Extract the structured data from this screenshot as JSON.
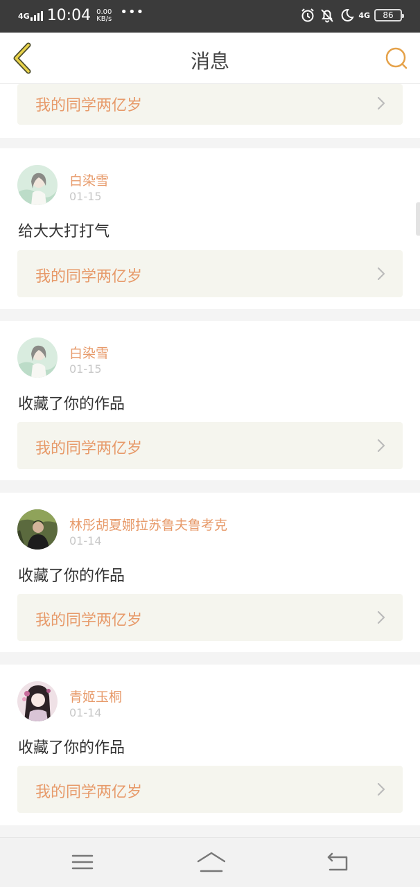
{
  "status_bar": {
    "network": "4G",
    "time": "10:04",
    "speed_value": "0.00",
    "speed_unit": "KB/s",
    "more": "•••",
    "network_right": "4G",
    "battery": "86",
    "icons": [
      "alarm-icon",
      "notifications-off-icon",
      "moon-icon"
    ]
  },
  "header": {
    "title": "消息",
    "accent_color": "#e5a24a"
  },
  "feed": {
    "top_partial_link": "我的同学两亿岁",
    "items": [
      {
        "name": "白染雪",
        "date": "01-15",
        "message": "给大大打打气",
        "work": "我的同学两亿岁"
      },
      {
        "name": "白染雪",
        "date": "01-15",
        "message": "收藏了你的作品",
        "work": "我的同学两亿岁"
      },
      {
        "name": "林彤胡夏娜拉苏鲁夫鲁考克",
        "date": "01-14",
        "message": "收藏了你的作品",
        "work": "我的同学两亿岁"
      },
      {
        "name": "青姬玉桐",
        "date": "01-14",
        "message": "收藏了你的作品",
        "work": "我的同学两亿岁"
      }
    ]
  },
  "colors": {
    "username": "#e79a6a",
    "link_bg": "#f5f5ee",
    "date": "#c8c8c8"
  },
  "navbar": {
    "buttons": [
      "menu-icon",
      "home-icon",
      "back-icon"
    ]
  }
}
